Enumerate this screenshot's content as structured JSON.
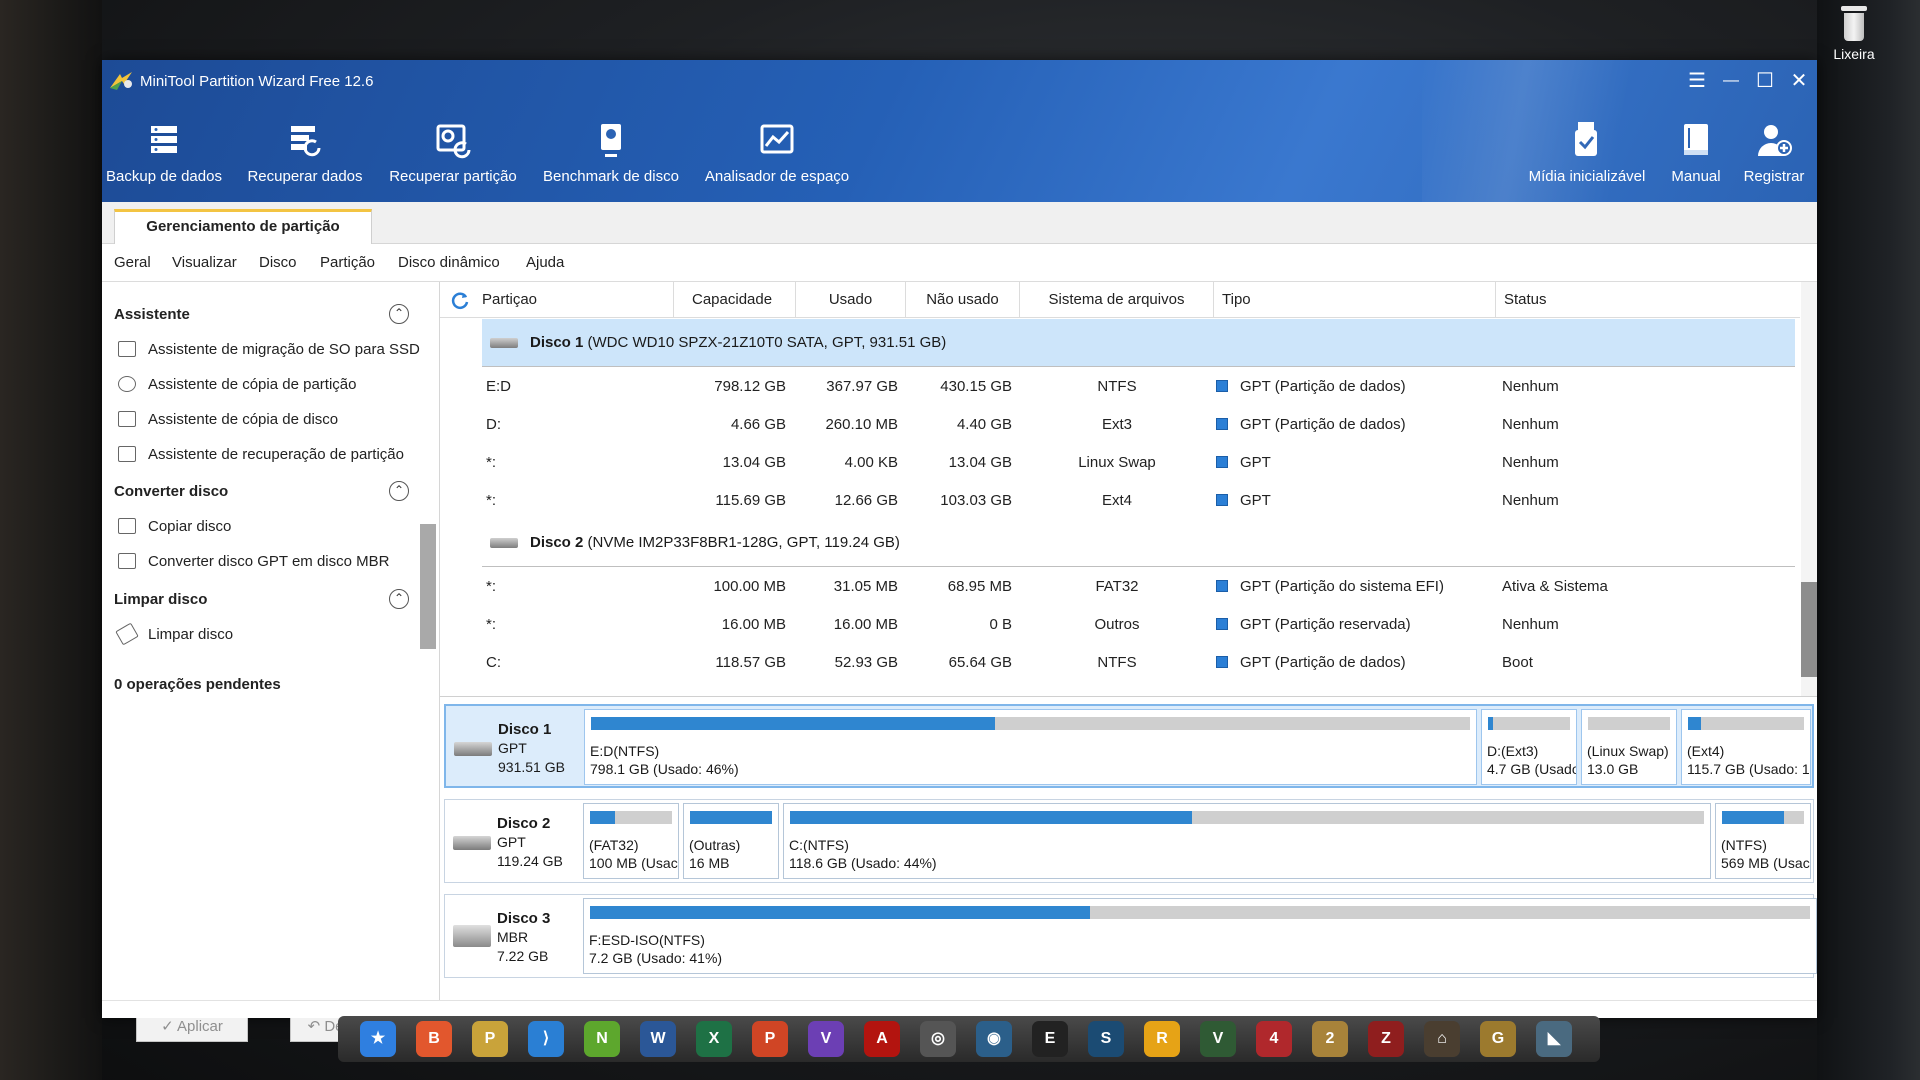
{
  "desktop": {
    "trash_label": "Lixeira"
  },
  "window": {
    "title": "MiniTool Partition Wizard Free 12.6",
    "controls": {
      "menu": "☰",
      "minimize": "—",
      "maximize": "☐",
      "close": "✕"
    }
  },
  "toolbar": {
    "items": [
      {
        "label": "Backup de dados",
        "icon": "backup-icon"
      },
      {
        "label": "Recuperar dados",
        "icon": "data-recovery-icon"
      },
      {
        "label": "Recuperar partição",
        "icon": "partition-recovery-icon"
      },
      {
        "label": "Benchmark de disco",
        "icon": "disk-benchmark-icon"
      },
      {
        "label": "Analisador de espaço",
        "icon": "space-analyzer-icon"
      }
    ],
    "right_items": [
      {
        "label": "Mídia inicializável",
        "icon": "bootable-media-icon"
      },
      {
        "label": "Manual",
        "icon": "manual-icon"
      },
      {
        "label": "Registrar",
        "icon": "register-icon"
      }
    ]
  },
  "tab": {
    "label": "Gerenciamento de partição"
  },
  "menu": [
    "Geral",
    "Visualizar",
    "Disco",
    "Partição",
    "Disco dinâmico",
    "Ajuda"
  ],
  "sidebar": {
    "sections": [
      {
        "title": "Assistente",
        "items": [
          "Assistente de migração de SO para SSD",
          "Assistente de cópia de partição",
          "Assistente de cópia de disco",
          "Assistente de recuperação de partição"
        ]
      },
      {
        "title": "Converter disco",
        "items": [
          "Copiar disco",
          "Converter disco GPT em disco MBR"
        ]
      },
      {
        "title": "Limpar disco",
        "items": [
          "Limpar disco"
        ]
      }
    ],
    "pending": "0 operações pendentes",
    "apply": "✓ Aplicar",
    "undo": "↶ Desfazer"
  },
  "grid": {
    "columns": [
      "Partiçao",
      "Capacidade",
      "Usado",
      "Não usado",
      "Sistema de arquivos",
      "Tipo",
      "Status"
    ],
    "disks": [
      {
        "label": "Disco 1",
        "detail": "(WDC WD10 SPZX-21Z10T0 SATA, GPT, 931.51 GB)",
        "partitions": [
          {
            "name": "E:D",
            "capacity": "798.12 GB",
            "used": "367.97 GB",
            "unused": "430.15 GB",
            "fs": "NTFS",
            "type": "GPT (Partição de dados)",
            "status": "Nenhum"
          },
          {
            "name": "D:",
            "capacity": "4.66 GB",
            "used": "260.10 MB",
            "unused": "4.40 GB",
            "fs": "Ext3",
            "type": "GPT (Partição de dados)",
            "status": "Nenhum"
          },
          {
            "name": "*:",
            "capacity": "13.04 GB",
            "used": "4.00 KB",
            "unused": "13.04 GB",
            "fs": "Linux Swap",
            "type": "GPT",
            "status": "Nenhum"
          },
          {
            "name": "*:",
            "capacity": "115.69 GB",
            "used": "12.66 GB",
            "unused": "103.03 GB",
            "fs": "Ext4",
            "type": "GPT",
            "status": "Nenhum"
          }
        ]
      },
      {
        "label": "Disco 2",
        "detail": "(NVMe IM2P33F8BR1-128G, GPT, 119.24 GB)",
        "partitions": [
          {
            "name": "*:",
            "capacity": "100.00 MB",
            "used": "31.05 MB",
            "unused": "68.95 MB",
            "fs": "FAT32",
            "type": "GPT (Partição do sistema EFI)",
            "status": "Ativa & Sistema"
          },
          {
            "name": "*:",
            "capacity": "16.00 MB",
            "used": "16.00 MB",
            "unused": "0 B",
            "fs": "Outros",
            "type": "GPT (Partição reservada)",
            "status": "Nenhum"
          },
          {
            "name": "C:",
            "capacity": "118.57 GB",
            "used": "52.93 GB",
            "unused": "65.64 GB",
            "fs": "NTFS",
            "type": "GPT (Partição de dados)",
            "status": "Boot"
          }
        ]
      }
    ]
  },
  "map": {
    "disks": [
      {
        "name": "Disco 1",
        "style": "GPT",
        "size": "931.51 GB",
        "selected": true,
        "parts": [
          {
            "l1": "E:D(NTFS)",
            "l2": "798.1 GB (Usado: 46%)",
            "used": 0.46
          },
          {
            "l1": "D:(Ext3)",
            "l2": "4.7 GB (Usado:",
            "used": 0.06
          },
          {
            "l1": "(Linux Swap)",
            "l2": "13.0 GB",
            "used": 0.0
          },
          {
            "l1": "(Ext4)",
            "l2": "115.7 GB (Usado: 1",
            "used": 0.11
          }
        ]
      },
      {
        "name": "Disco 2",
        "style": "GPT",
        "size": "119.24 GB",
        "selected": false,
        "parts": [
          {
            "l1": "(FAT32)",
            "l2": "100 MB (Usac",
            "used": 0.31
          },
          {
            "l1": "(Outras)",
            "l2": "16 MB",
            "used": 1.0
          },
          {
            "l1": "C:(NTFS)",
            "l2": "118.6 GB (Usado: 44%)",
            "used": 0.44
          },
          {
            "l1": "(NTFS)",
            "l2": "569 MB (Usac",
            "used": 0.75
          }
        ]
      },
      {
        "name": "Disco 3",
        "style": "MBR",
        "size": "7.22 GB",
        "selected": false,
        "parts": [
          {
            "l1": "F:ESD-ISO(NTFS)",
            "l2": "7.2 GB (Usado: 41%)",
            "used": 0.41
          }
        ]
      }
    ]
  },
  "taskbar": {
    "apps": [
      {
        "name": "starred-app",
        "glyph": "★",
        "color": "#2f7fe0"
      },
      {
        "name": "brave-browser",
        "glyph": "B",
        "color": "#e2572d"
      },
      {
        "name": "partition-wizard",
        "glyph": "P",
        "color": "#c9a33a"
      },
      {
        "name": "vscode",
        "glyph": "⟩",
        "color": "#2a7fd4"
      },
      {
        "name": "nvidia",
        "glyph": "N",
        "color": "#5da72d"
      },
      {
        "name": "word",
        "glyph": "W",
        "color": "#2b5797"
      },
      {
        "name": "excel",
        "glyph": "X",
        "color": "#1e7145"
      },
      {
        "name": "powerpoint",
        "glyph": "P",
        "color": "#d04525"
      },
      {
        "name": "visual-studio",
        "glyph": "V",
        "color": "#6c3fb4"
      },
      {
        "name": "acrobat",
        "glyph": "A",
        "color": "#b3140f"
      },
      {
        "name": "app-ring",
        "glyph": "◎",
        "color": "#555555"
      },
      {
        "name": "app-swirl",
        "glyph": "◉",
        "color": "#2b5f8a"
      },
      {
        "name": "epic-games",
        "glyph": "E",
        "color": "#222222"
      },
      {
        "name": "steam",
        "glyph": "S",
        "color": "#1b4b73"
      },
      {
        "name": "rockstar",
        "glyph": "R",
        "color": "#e6a316"
      },
      {
        "name": "valorant",
        "glyph": "V",
        "color": "#2f5a34"
      },
      {
        "name": "game-4",
        "glyph": "4",
        "color": "#b0282c"
      },
      {
        "name": "game-2",
        "glyph": "2",
        "color": "#a8833a"
      },
      {
        "name": "game-za",
        "glyph": "Z",
        "color": "#8f1e1e"
      },
      {
        "name": "game-door",
        "glyph": "⌂",
        "color": "#4a3e30"
      },
      {
        "name": "csgo",
        "glyph": "G",
        "color": "#9c7a2e"
      },
      {
        "name": "app-shark",
        "glyph": "◣",
        "color": "#4a6a80"
      }
    ]
  }
}
